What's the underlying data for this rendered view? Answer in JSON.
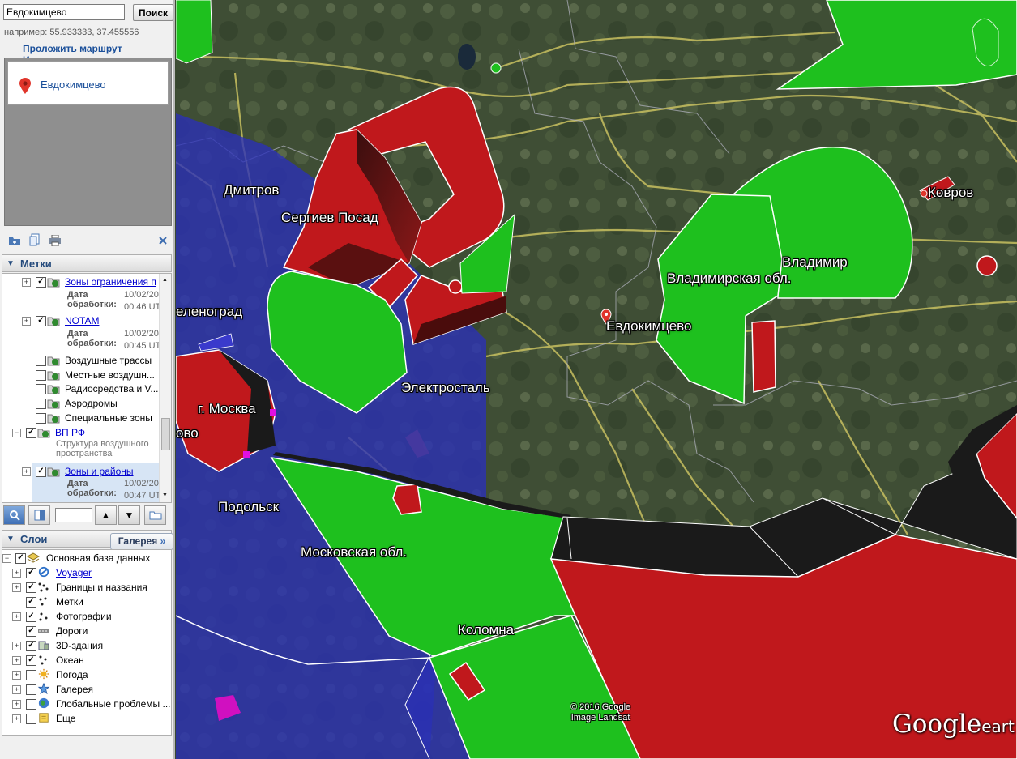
{
  "search": {
    "value": "Евдокимцево",
    "button": "Поиск",
    "example": "например: 55.933333, 37.455556"
  },
  "links": {
    "route": "Проложить маршрут",
    "history": "История"
  },
  "result": {
    "title": "Евдокимцево"
  },
  "places": {
    "title": "Метки",
    "items": [
      {
        "label": "Зоны ограничения п",
        "checked": true,
        "link": true,
        "meta_label": "Дата обработки:",
        "meta_date": "10/02/20",
        "meta_time": "00:46 UT"
      },
      {
        "label": "NOTAM",
        "checked": true,
        "link": true,
        "meta_label": "Дата обработки:",
        "meta_date": "10/02/20",
        "meta_time": "00:45 UT"
      },
      {
        "label": "Воздушные трассы",
        "checked": false
      },
      {
        "label": "Местные воздушн...",
        "checked": false
      },
      {
        "label": "Радиосредства и V...",
        "checked": false
      },
      {
        "label": "Аэродромы",
        "checked": false
      },
      {
        "label": "Специальные зоны",
        "checked": false
      },
      {
        "label": "ВП РФ",
        "checked": true,
        "link": true,
        "description": "Структура воздушного пространства"
      },
      {
        "label": "Зоны и районы",
        "checked": true,
        "link": true,
        "meta_label": "Дата обработки:",
        "meta_date": "10/02/20",
        "meta_time": "00:47 UT"
      }
    ]
  },
  "layers": {
    "title": "Слои",
    "gallery_button": "Галерея",
    "items": [
      {
        "label": "Основная база данных",
        "checked": true
      },
      {
        "label": "Voyager",
        "checked": true,
        "link": true
      },
      {
        "label": "Границы и названия",
        "checked": true
      },
      {
        "label": "Метки",
        "checked": true
      },
      {
        "label": "Фотографии",
        "checked": true
      },
      {
        "label": "Дороги",
        "checked": true
      },
      {
        "label": "3D-здания",
        "checked": true
      },
      {
        "label": "Океан",
        "checked": true
      },
      {
        "label": "Погода",
        "checked": false
      },
      {
        "label": "Галерея",
        "checked": false
      },
      {
        "label": "Глобальные проблемы ...",
        "checked": false
      },
      {
        "label": "Еще",
        "checked": false
      }
    ]
  },
  "map": {
    "labels": {
      "dmitrov": "Дмитров",
      "sergiev_posad": "Сергиев Посад",
      "zelenograd": "еленоград",
      "moscow": "г. Москва",
      "odintsovo": "ово",
      "elektrostal": "Электросталь",
      "podolsk": "Подольск",
      "moscow_obl": "Московская обл.",
      "kolomna": "Коломна",
      "vladimir": "Владимир",
      "vladimir_obl": "Владимирская обл.",
      "evdokimtsevo": "Евдокимцево",
      "kovrov": "Ковров"
    },
    "copyright_line1": "© 2016 Google",
    "copyright_line2": "Image Landsat",
    "logo_text": "Google",
    "logo_suffix": "eart",
    "colors": {
      "restricted_zone": "#c0181c",
      "airspace": "#2a2fb8",
      "zone_green": "#1ec01e",
      "shadow": "#1a1a1a",
      "road": "#c8c060"
    }
  }
}
